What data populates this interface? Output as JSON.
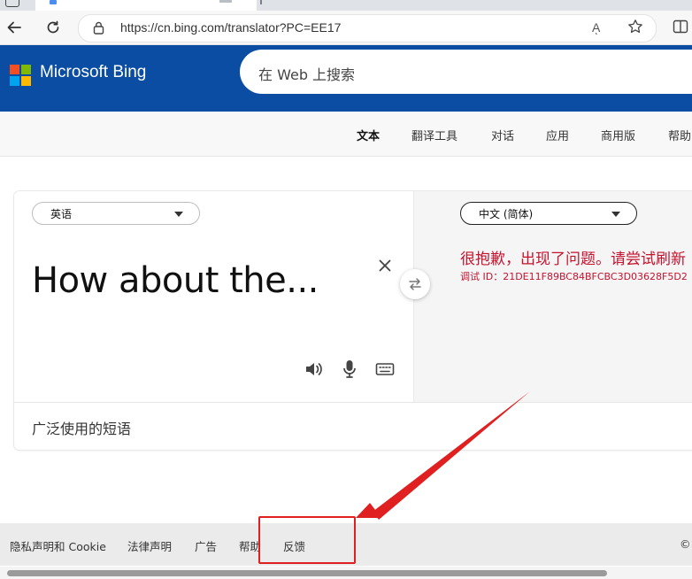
{
  "browser": {
    "url": "https://cn.bing.com/translator?PC=EE17",
    "read_aloud_label": "Aͅ"
  },
  "header": {
    "brand": "Microsoft Bing",
    "search_placeholder": "在 Web 上搜索"
  },
  "subnav": {
    "items": [
      "文本",
      "翻译工具",
      "对话",
      "应用",
      "商用版",
      "帮助"
    ]
  },
  "translator": {
    "source_language": "英语",
    "target_language": "中文 (简体)",
    "source_text": "How about the...",
    "error_message": "很抱歉，出现了问题。请尝试刷新",
    "error_debug_id": "调试 ID：21DE11F89BC84BFCBC3D03628F5D2",
    "common_phrases_label": "广泛使用的短语"
  },
  "footer": {
    "links": [
      "隐私声明和 Cookie",
      "法律声明",
      "广告",
      "帮助",
      "反馈"
    ],
    "copyright": "©"
  },
  "colors": {
    "bing_blue": "#0a4da2",
    "error_red": "#c4122f",
    "annotation_red": "#e02020"
  }
}
